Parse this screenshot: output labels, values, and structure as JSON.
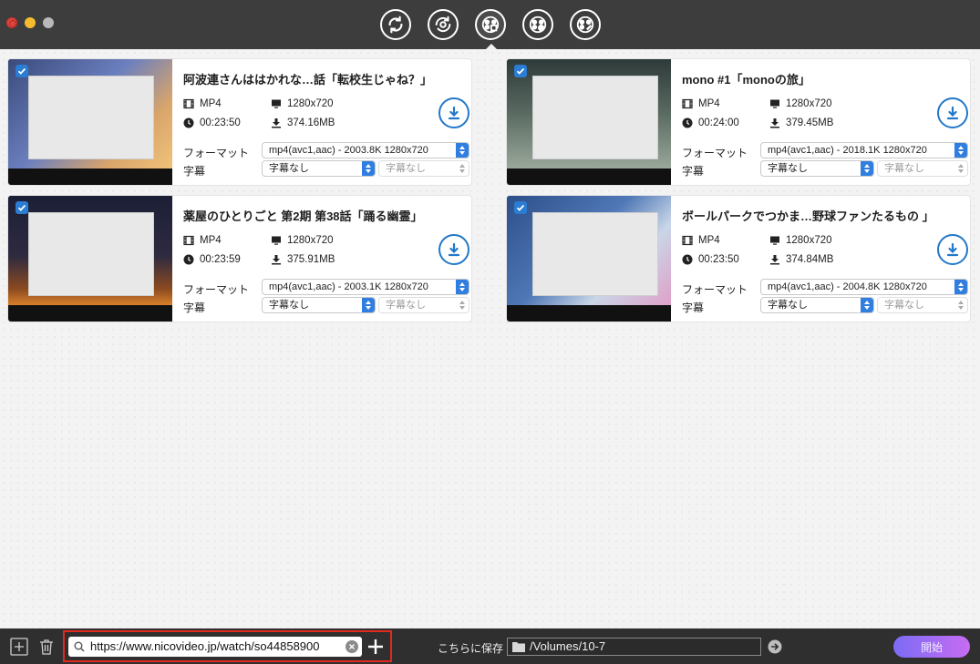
{
  "toolbar": {
    "buttons": [
      {
        "name": "convert"
      },
      {
        "name": "dvd-convert"
      },
      {
        "name": "download",
        "active": true
      },
      {
        "name": "record"
      },
      {
        "name": "toolbox"
      }
    ]
  },
  "videos": [
    {
      "title": "阿波連さんははかれな…話「転校生じゃね？」",
      "format": "MP4",
      "resolution": "1280x720",
      "duration": "00:23:50",
      "size": "374.16MB",
      "format_label": "フォーマット",
      "format_value": "mp4(avc1,aac) - 2003.8K 1280x720",
      "subtitle_label": "字幕",
      "subtitle_value": "字幕なし",
      "subtitle_value2": "字幕なし"
    },
    {
      "title": "mono #1「monoの旅」",
      "format": "MP4",
      "resolution": "1280x720",
      "duration": "00:24:00",
      "size": "379.45MB",
      "format_label": "フォーマット",
      "format_value": "mp4(avc1,aac) - 2018.1K 1280x720",
      "subtitle_label": "字幕",
      "subtitle_value": "字幕なし",
      "subtitle_value2": "字幕なし"
    },
    {
      "title": "薬屋のひとりごと 第2期 第38話「踊る幽霊」",
      "format": "MP4",
      "resolution": "1280x720",
      "duration": "00:23:59",
      "size": "375.91MB",
      "format_label": "フォーマット",
      "format_value": "mp4(avc1,aac) - 2003.1K 1280x720",
      "subtitle_label": "字幕",
      "subtitle_value": "字幕なし",
      "subtitle_value2": "字幕なし"
    },
    {
      "title": "ボールパークでつかま…野球ファンたるもの 」",
      "format": "MP4",
      "resolution": "1280x720",
      "duration": "00:23:50",
      "size": "374.84MB",
      "format_label": "フォーマット",
      "format_value": "mp4(avc1,aac) - 2004.8K 1280x720",
      "subtitle_label": "字幕",
      "subtitle_value": "字幕なし",
      "subtitle_value2": "字幕なし"
    }
  ],
  "bottom": {
    "url_value": "https://www.nicovideo.jp/watch/so44858900",
    "save_label": "こちらに保存",
    "save_path": "/Volumes/10-7",
    "start_label": "開始"
  },
  "colors": {
    "accent": "#2278c8",
    "highlight": "#e02a1e",
    "start_gradient": [
      "#7b6cf5",
      "#c76cf2"
    ]
  }
}
